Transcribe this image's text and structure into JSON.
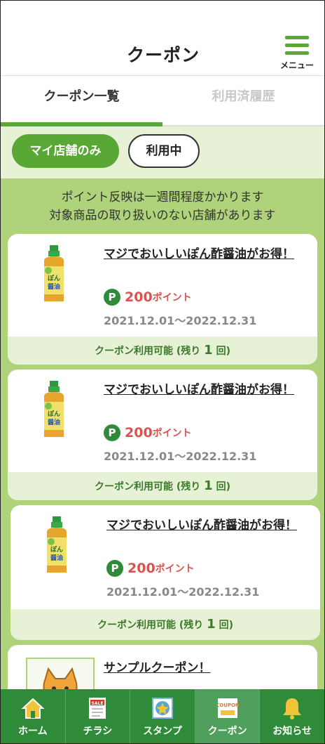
{
  "header": {
    "title": "クーポン",
    "menu_label": "メニュー"
  },
  "tabs": [
    {
      "label": "クーポン一覧",
      "active": true
    },
    {
      "label": "利用済履歴",
      "active": false
    }
  ],
  "filters": [
    {
      "label": "マイ店舗のみ",
      "active": true
    },
    {
      "label": "利用中",
      "active": false
    }
  ],
  "notice": {
    "line1": "ポイント反映は一週間程度かかります",
    "line2": "対象商品の取り扱いのない店舗があります"
  },
  "coupons": [
    {
      "title": "マジでおいしいぽん酢醤油がお得！",
      "points": "200",
      "points_unit": "ポイント",
      "period": "2021.12.01〜2022.12.31",
      "status_prefix": "クーポン利用可能 (残り ",
      "remaining": "1",
      "status_suffix": " 回)"
    },
    {
      "title": "マジでおいしいぽん酢醤油がお得！",
      "points": "200",
      "points_unit": "ポイント",
      "period": "2021.12.01〜2022.12.31",
      "status_prefix": "クーポン利用可能 (残り ",
      "remaining": "1",
      "status_suffix": " 回)"
    },
    {
      "title": "マジでおいしいぽん酢醤油がお得！",
      "points": "200",
      "points_unit": "ポイント",
      "period": "2021.12.01〜2022.12.31",
      "status_prefix": "クーポン利用可能 (残り ",
      "remaining": "1",
      "status_suffix": " 回)"
    },
    {
      "title": "サンプルクーポン！"
    }
  ],
  "nav": [
    {
      "label": "ホーム",
      "icon": "home-icon"
    },
    {
      "label": "チラシ",
      "icon": "flyer-icon",
      "icon_text": "SALE"
    },
    {
      "label": "スタンプ",
      "icon": "stamp-icon"
    },
    {
      "label": "クーポン",
      "icon": "coupon-icon",
      "icon_text": "COUPON",
      "active": true
    },
    {
      "label": "お知らせ",
      "icon": "bell-icon"
    }
  ],
  "p_badge": "P",
  "colors": {
    "brand_green": "#59a735",
    "nav_green": "#2f8b3a",
    "points_red": "#d9534f",
    "content_bg": "#aed37a"
  }
}
